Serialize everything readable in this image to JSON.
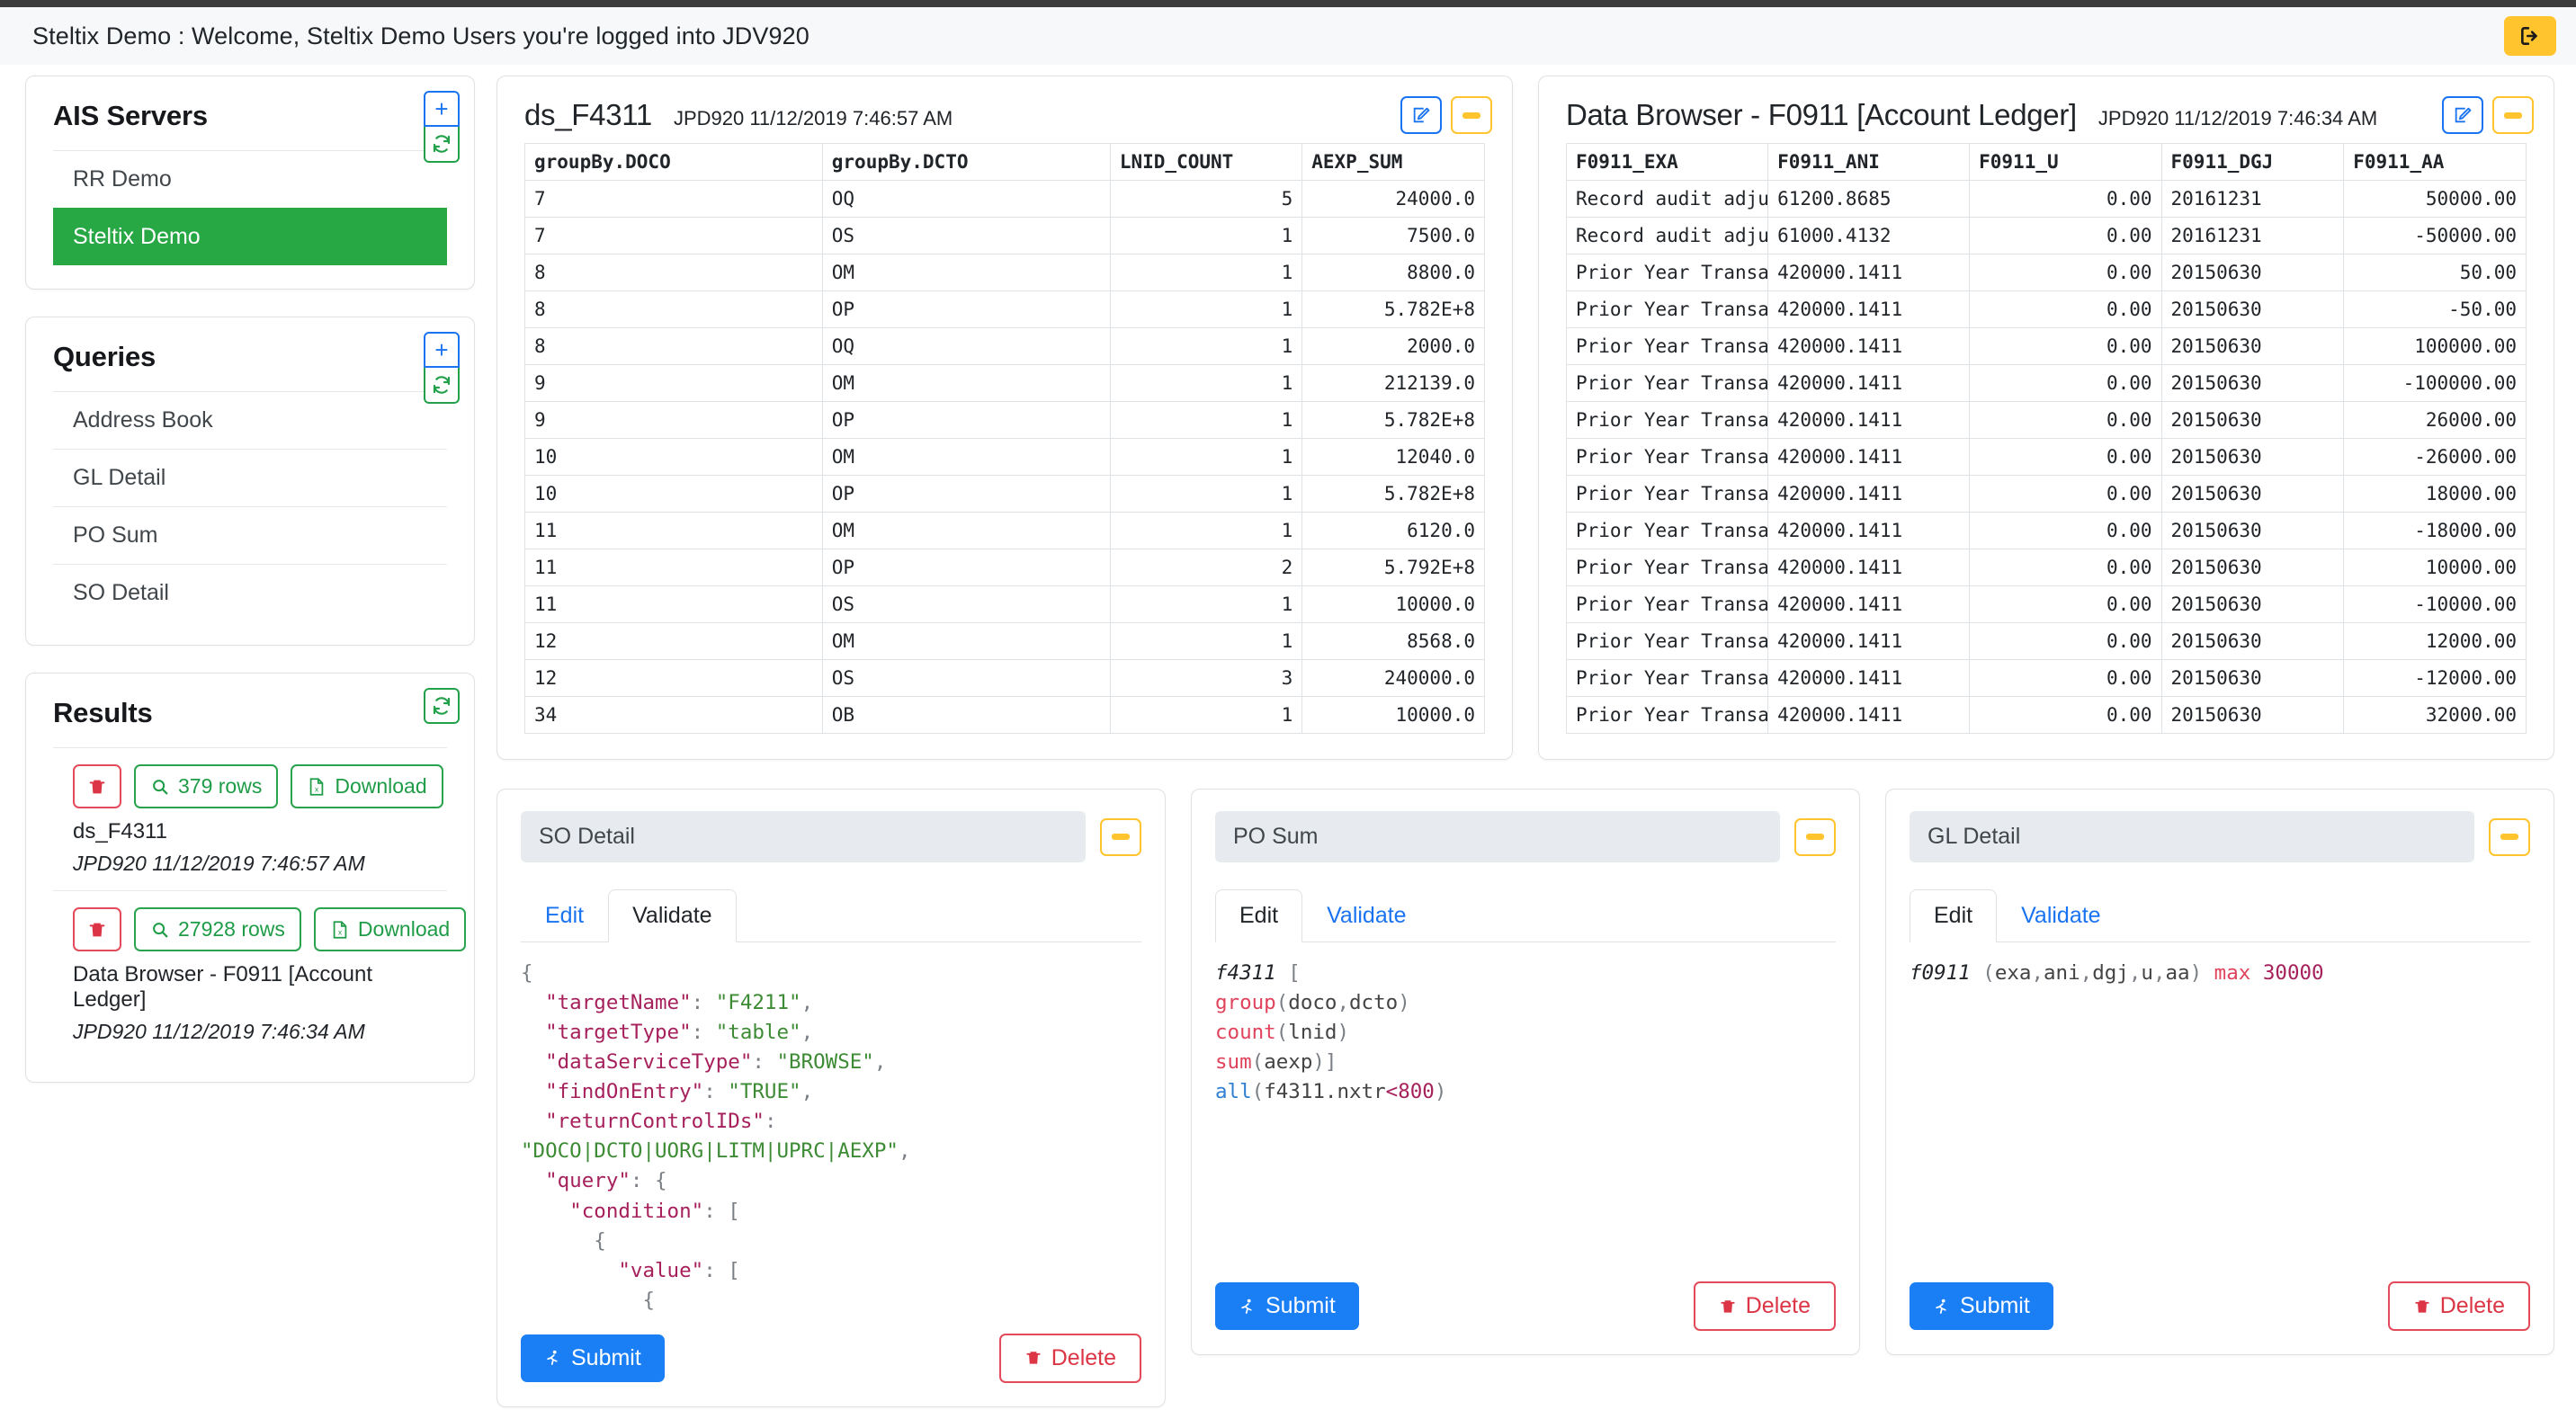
{
  "topbar": {
    "title": "Steltix Demo : Welcome, Steltix Demo Users you're logged into JDV920",
    "logout_icon": "logout-icon"
  },
  "sidebar": {
    "servers": {
      "title": "AIS Servers",
      "add_label": "+",
      "refresh_icon": "refresh-icon",
      "items": [
        {
          "label": "RR Demo",
          "selected": false
        },
        {
          "label": "Steltix Demo",
          "selected": true
        }
      ]
    },
    "queries": {
      "title": "Queries",
      "add_label": "+",
      "refresh_icon": "refresh-icon",
      "items": [
        {
          "label": "Address Book"
        },
        {
          "label": "GL Detail"
        },
        {
          "label": "PO Sum"
        },
        {
          "label": "SO Detail"
        }
      ]
    },
    "results": {
      "title": "Results",
      "refresh_icon": "refresh-icon",
      "items": [
        {
          "delete_icon": "trash-icon",
          "rows_label": "379 rows",
          "download_label": "Download",
          "name": "ds_F4311",
          "stamp": "JPD920 11/12/2019 7:46:57 AM"
        },
        {
          "delete_icon": "trash-icon",
          "rows_label": "27928 rows",
          "download_label": "Download",
          "name": "Data Browser - F0911 [Account Ledger]",
          "stamp": "JPD920 11/12/2019 7:46:34 AM"
        }
      ]
    }
  },
  "panels": {
    "ds_f4311": {
      "title": "ds_F4311",
      "stamp": "JPD920 11/12/2019 7:46:57 AM",
      "edit_icon": "edit-icon",
      "minimize_icon": "minimize-icon",
      "columns": [
        "groupBy.DOCO",
        "groupBy.DCTO",
        "LNID_COUNT",
        "AEXP_SUM"
      ],
      "rows": [
        [
          "7",
          "OQ",
          "5",
          "24000.0"
        ],
        [
          "7",
          "OS",
          "1",
          "7500.0"
        ],
        [
          "8",
          "OM",
          "1",
          "8800.0"
        ],
        [
          "8",
          "OP",
          "1",
          "5.782E+8"
        ],
        [
          "8",
          "OQ",
          "1",
          "2000.0"
        ],
        [
          "9",
          "OM",
          "1",
          "212139.0"
        ],
        [
          "9",
          "OP",
          "1",
          "5.782E+8"
        ],
        [
          "10",
          "OM",
          "1",
          "12040.0"
        ],
        [
          "10",
          "OP",
          "1",
          "5.782E+8"
        ],
        [
          "11",
          "OM",
          "1",
          "6120.0"
        ],
        [
          "11",
          "OP",
          "2",
          "5.792E+8"
        ],
        [
          "11",
          "OS",
          "1",
          "10000.0"
        ],
        [
          "12",
          "OM",
          "1",
          "8568.0"
        ],
        [
          "12",
          "OS",
          "3",
          "240000.0"
        ],
        [
          "34",
          "OB",
          "1",
          "10000.0"
        ]
      ]
    },
    "data_browser": {
      "title": "Data Browser - F0911 [Account Ledger]",
      "stamp": "JPD920 11/12/2019 7:46:34 AM",
      "edit_icon": "edit-icon",
      "minimize_icon": "minimize-icon",
      "columns": [
        "F0911_EXA",
        "F0911_ANI",
        "F0911_U",
        "F0911_DGJ",
        "F0911_AA"
      ],
      "rows": [
        [
          "Record audit adjust",
          "61200.8685",
          "0.00",
          "20161231",
          "50000.00"
        ],
        [
          "Record audit adjust",
          "61000.4132",
          "0.00",
          "20161231",
          "-50000.00"
        ],
        [
          "Prior Year Transact",
          "420000.1411",
          "0.00",
          "20150630",
          "50.00"
        ],
        [
          "Prior Year Transact",
          "420000.1411",
          "0.00",
          "20150630",
          "-50.00"
        ],
        [
          "Prior Year Transact",
          "420000.1411",
          "0.00",
          "20150630",
          "100000.00"
        ],
        [
          "Prior Year Transact",
          "420000.1411",
          "0.00",
          "20150630",
          "-100000.00"
        ],
        [
          "Prior Year Transact",
          "420000.1411",
          "0.00",
          "20150630",
          "26000.00"
        ],
        [
          "Prior Year Transact",
          "420000.1411",
          "0.00",
          "20150630",
          "-26000.00"
        ],
        [
          "Prior Year Transact",
          "420000.1411",
          "0.00",
          "20150630",
          "18000.00"
        ],
        [
          "Prior Year Transact",
          "420000.1411",
          "0.00",
          "20150630",
          "-18000.00"
        ],
        [
          "Prior Year Transact",
          "420000.1411",
          "0.00",
          "20150630",
          "10000.00"
        ],
        [
          "Prior Year Transact",
          "420000.1411",
          "0.00",
          "20150630",
          "-10000.00"
        ],
        [
          "Prior Year Transact",
          "420000.1411",
          "0.00",
          "20150630",
          "12000.00"
        ],
        [
          "Prior Year Transact",
          "420000.1411",
          "0.00",
          "20150630",
          "-12000.00"
        ],
        [
          "Prior Year Transact",
          "420000.1411",
          "0.00",
          "20150630",
          "32000.00"
        ]
      ]
    }
  },
  "editors": [
    {
      "name": "SO Detail",
      "minimize_icon": "minimize-icon",
      "tabs": [
        {
          "label": "Edit",
          "active": false
        },
        {
          "label": "Validate",
          "active": true
        }
      ],
      "submit_label": "Submit",
      "delete_label": "Delete",
      "submit_icon": "run-icon",
      "delete_icon": "trash-icon"
    },
    {
      "name": "PO Sum",
      "minimize_icon": "minimize-icon",
      "tabs": [
        {
          "label": "Edit",
          "active": true
        },
        {
          "label": "Validate",
          "active": false
        }
      ],
      "submit_label": "Submit",
      "delete_label": "Delete",
      "submit_icon": "run-icon",
      "delete_icon": "trash-icon"
    },
    {
      "name": "GL Detail",
      "minimize_icon": "minimize-icon",
      "tabs": [
        {
          "label": "Edit",
          "active": true
        },
        {
          "label": "Validate",
          "active": false
        }
      ],
      "submit_label": "Submit",
      "delete_label": "Delete",
      "submit_icon": "run-icon",
      "delete_icon": "trash-icon"
    }
  ],
  "code": {
    "so_detail": "{\n  \"targetName\": \"F4211\",\n  \"targetType\": \"table\",\n  \"dataServiceType\": \"BROWSE\",\n  \"findOnEntry\": \"TRUE\",\n  \"returnControlIDs\":\n\"DOCO|DCTO|UORG|LITM|UPRC|AEXP\",\n  \"query\": {\n    \"condition\": [\n      {\n        \"value\": [\n          {",
    "po_sum": "f4311 [\ngroup(doco,dcto)\ncount(lnid)\nsum(aexp)]\nall(f4311.nxtr<800)",
    "gl_detail": "f0911 (exa,ani,dgj,u,aa) max 30000"
  },
  "colors": {
    "accent_blue": "#1a73f0",
    "accent_green": "#28a745",
    "accent_yellow": "#ffc42e",
    "accent_red": "#dc3545"
  }
}
